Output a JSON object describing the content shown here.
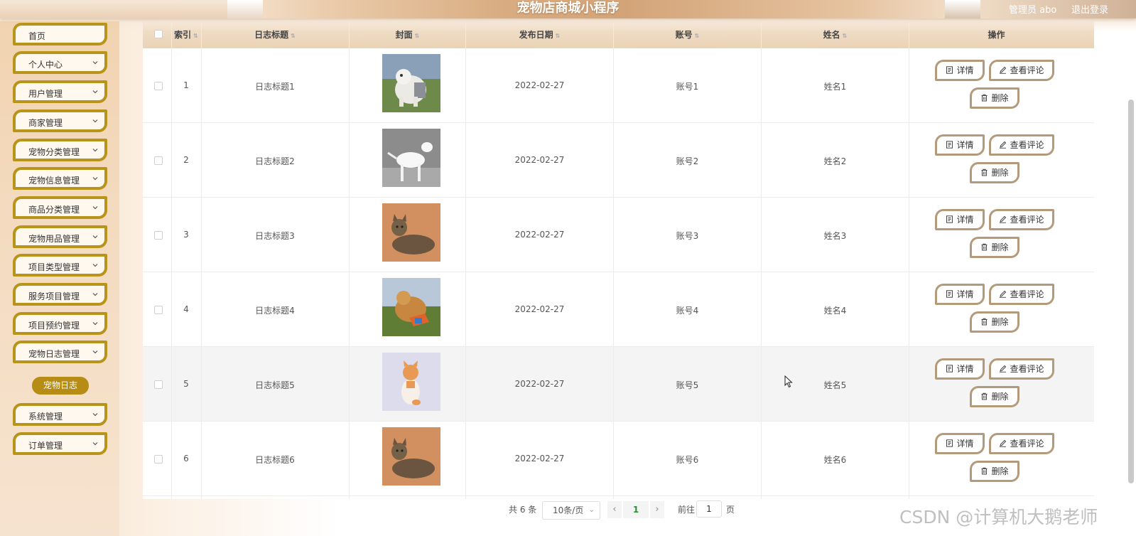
{
  "header": {
    "title": "宠物店商城小程序",
    "admin": "管理员 abo",
    "logout": "退出登录"
  },
  "sidebar": {
    "items": [
      {
        "label": "首页"
      },
      {
        "label": "个人中心"
      },
      {
        "label": "用户管理"
      },
      {
        "label": "商家管理"
      },
      {
        "label": "宠物分类管理"
      },
      {
        "label": "宠物信息管理"
      },
      {
        "label": "商品分类管理"
      },
      {
        "label": "宠物用品管理"
      },
      {
        "label": "项目类型管理"
      },
      {
        "label": "服务项目管理"
      },
      {
        "label": "项目预约管理"
      },
      {
        "label": "宠物日志管理"
      },
      {
        "label": "系统管理"
      },
      {
        "label": "订单管理"
      }
    ],
    "active_sub": "宠物日志",
    "accent_color": "#b8941a"
  },
  "table": {
    "columns": [
      "索引",
      "日志标题",
      "封面",
      "发布日期",
      "账号",
      "姓名",
      "操作"
    ],
    "rows": [
      {
        "index": "1",
        "title": "日志标题1",
        "date": "2022-02-27",
        "account": "账号1",
        "name": "姓名1",
        "cover": "sheepdog photo"
      },
      {
        "index": "2",
        "title": "日志标题2",
        "date": "2022-02-27",
        "account": "账号2",
        "name": "姓名2",
        "cover": "bull terrier photo"
      },
      {
        "index": "3",
        "title": "日志标题3",
        "date": "2022-02-27",
        "account": "账号3",
        "name": "姓名3",
        "cover": "tabby cat photo"
      },
      {
        "index": "4",
        "title": "日志标题4",
        "date": "2022-02-27",
        "account": "账号4",
        "name": "姓名4",
        "cover": "golden retriever photo"
      },
      {
        "index": "5",
        "title": "日志标题5",
        "date": "2022-02-27",
        "account": "账号5",
        "name": "姓名5",
        "cover": "orange kitten photo"
      },
      {
        "index": "6",
        "title": "日志标题6",
        "date": "2022-02-27",
        "account": "账号6",
        "name": "姓名6",
        "cover": "tabby cat photo"
      }
    ],
    "actions": {
      "detail": "详情",
      "comments": "查看评论",
      "delete": "删除"
    }
  },
  "pagination": {
    "total": "共 6 条",
    "page_size": "10条/页",
    "current_page": "1",
    "goto_label": "前往",
    "goto_value": "1",
    "page_unit": "页"
  },
  "watermark": "CSDN @计算机大鹅老师"
}
